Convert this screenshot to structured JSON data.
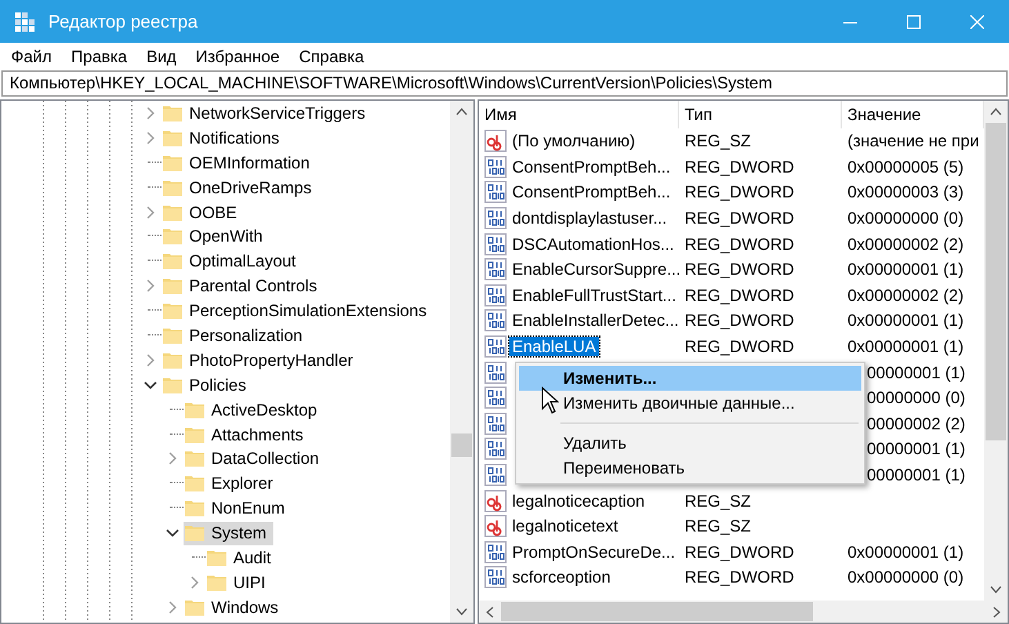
{
  "window": {
    "title": "Редактор реестра"
  },
  "menu": [
    "Файл",
    "Правка",
    "Вид",
    "Избранное",
    "Справка"
  ],
  "address": "Компьютер\\HKEY_LOCAL_MACHINE\\SOFTWARE\\Microsoft\\Windows\\CurrentVersion\\Policies\\System",
  "tree": [
    {
      "kind": "branch",
      "label": "NetworkServiceTriggers",
      "expanded": false,
      "selected": false
    },
    {
      "kind": "branch",
      "label": "Notifications",
      "expanded": false,
      "selected": false
    },
    {
      "kind": "leaf",
      "label": "OEMInformation",
      "selected": false
    },
    {
      "kind": "leaf",
      "label": "OneDriveRamps",
      "selected": false
    },
    {
      "kind": "branch",
      "label": "OOBE",
      "expanded": false,
      "selected": false
    },
    {
      "kind": "leaf",
      "label": "OpenWith",
      "selected": false
    },
    {
      "kind": "leaf",
      "label": "OptimalLayout",
      "selected": false
    },
    {
      "kind": "branch",
      "label": "Parental Controls",
      "expanded": false,
      "selected": false
    },
    {
      "kind": "leaf",
      "label": "PerceptionSimulationExtensions",
      "selected": false
    },
    {
      "kind": "leaf",
      "label": "Personalization",
      "selected": false
    },
    {
      "kind": "branch",
      "label": "PhotoPropertyHandler",
      "expanded": false,
      "selected": false
    },
    {
      "kind": "branch",
      "label": "Policies",
      "expanded": true,
      "selected": false,
      "children": [
        {
          "kind": "leaf",
          "label": "ActiveDesktop",
          "selected": false
        },
        {
          "kind": "leaf",
          "label": "Attachments",
          "selected": false
        },
        {
          "kind": "branch",
          "label": "DataCollection",
          "expanded": false,
          "selected": false
        },
        {
          "kind": "leaf",
          "label": "Explorer",
          "selected": false
        },
        {
          "kind": "leaf",
          "label": "NonEnum",
          "selected": false
        },
        {
          "kind": "branch",
          "label": "System",
          "expanded": true,
          "selected": true,
          "children": [
            {
              "kind": "leaf",
              "label": "Audit",
              "selected": false
            },
            {
              "kind": "branch",
              "label": "UIPI",
              "expanded": false,
              "selected": false
            }
          ]
        },
        {
          "kind": "branch",
          "label": "Windows",
          "expanded": false,
          "selected": false
        }
      ]
    }
  ],
  "columns": [
    "Имя",
    "Тип",
    "Значение"
  ],
  "values": [
    {
      "kind": "string",
      "name": "(По умолчанию)",
      "type": "REG_SZ",
      "value": "(значение не при",
      "selected": false
    },
    {
      "kind": "dword",
      "name": "ConsentPromptBeh...",
      "type": "REG_DWORD",
      "value": "0x00000005 (5)",
      "selected": false
    },
    {
      "kind": "dword",
      "name": "ConsentPromptBeh...",
      "type": "REG_DWORD",
      "value": "0x00000003 (3)",
      "selected": false
    },
    {
      "kind": "dword",
      "name": "dontdisplaylastuser...",
      "type": "REG_DWORD",
      "value": "0x00000000 (0)",
      "selected": false
    },
    {
      "kind": "dword",
      "name": "DSCAutomationHos...",
      "type": "REG_DWORD",
      "value": "0x00000002 (2)",
      "selected": false
    },
    {
      "kind": "dword",
      "name": "EnableCursorSuppre...",
      "type": "REG_DWORD",
      "value": "0x00000001 (1)",
      "selected": false
    },
    {
      "kind": "dword",
      "name": "EnableFullTrustStart...",
      "type": "REG_DWORD",
      "value": "0x00000002 (2)",
      "selected": false
    },
    {
      "kind": "dword",
      "name": "EnableInstallerDetec...",
      "type": "REG_DWORD",
      "value": "0x00000001 (1)",
      "selected": false
    },
    {
      "kind": "dword",
      "name": "EnableLUA",
      "type": "REG_DWORD",
      "value": "0x00000001 (1)",
      "selected": true
    },
    {
      "kind": "dword",
      "value": "00000001 (1)"
    },
    {
      "kind": "dword",
      "value": "00000000 (0)"
    },
    {
      "kind": "dword",
      "value": "00000002 (2)"
    },
    {
      "kind": "dword",
      "value": "00000001 (1)"
    },
    {
      "kind": "dword",
      "value": "00000001 (1)"
    },
    {
      "kind": "string",
      "name": "legalnoticecaption",
      "type": "REG_SZ",
      "selected": false
    },
    {
      "kind": "string",
      "name": "legalnoticetext",
      "type": "REG_SZ",
      "selected": false
    },
    {
      "kind": "dword",
      "name": "PromptOnSecureDe...",
      "type": "REG_DWORD",
      "value": "0x00000001 (1)",
      "selected": false
    },
    {
      "kind": "dword",
      "name": "scforceoption",
      "type": "REG_DWORD",
      "value": "0x00000000 (0)",
      "selected": false
    }
  ],
  "context_menu": [
    {
      "kind": "item",
      "label": "Изменить...",
      "selected": true
    },
    {
      "kind": "item",
      "label": "Изменить двоичные данные...",
      "selected": false
    },
    {
      "kind": "separator"
    },
    {
      "kind": "item",
      "label": "Удалить",
      "selected": false
    },
    {
      "kind": "item",
      "label": "Переименовать",
      "selected": false
    }
  ]
}
